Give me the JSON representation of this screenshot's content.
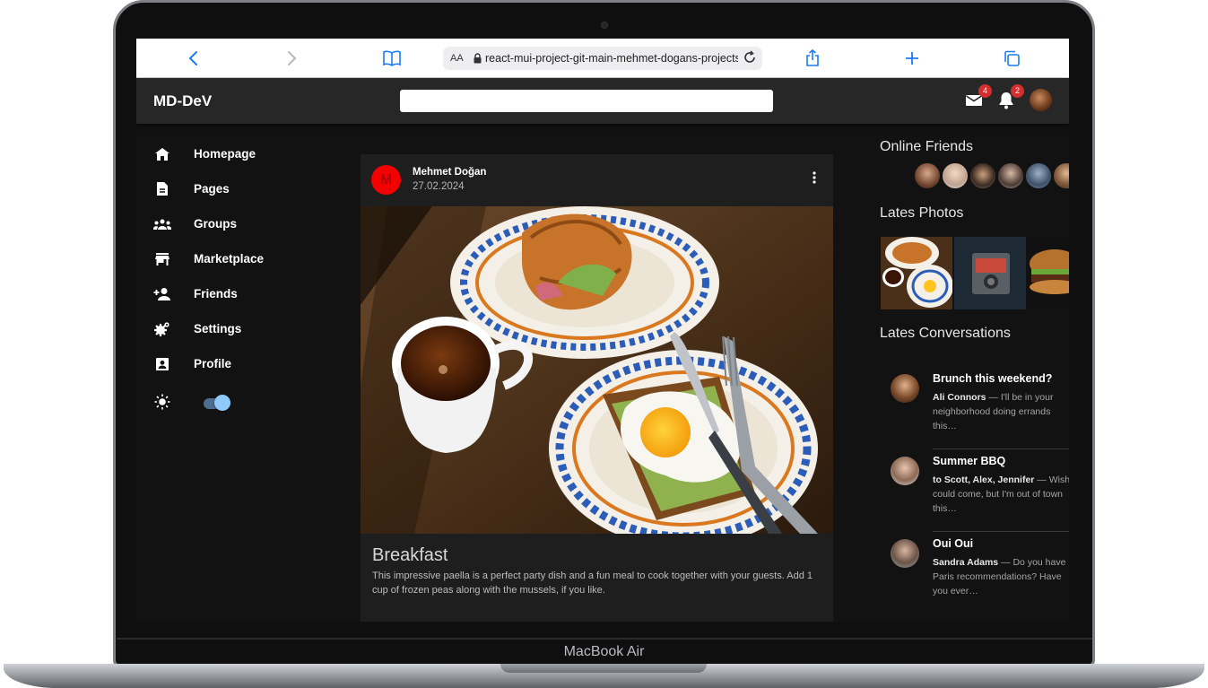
{
  "device": {
    "brand_label": "MacBook Air"
  },
  "browser": {
    "text_size_label": "AA",
    "url": "react-mui-project-git-main-mehmet-dogans-projects.vercel.app",
    "icons": [
      "chevron-left-icon",
      "chevron-right-icon",
      "book-icon",
      "lock-icon",
      "reload-icon",
      "share-icon",
      "plus-icon",
      "tabs-icon"
    ]
  },
  "appbar": {
    "logo": "MD-DeV",
    "search_placeholder": "",
    "mail_badge": "4",
    "notifications_badge": "2"
  },
  "sidebar": {
    "items": [
      {
        "label": "Homepage",
        "icon": "home-icon"
      },
      {
        "label": "Pages",
        "icon": "article-icon"
      },
      {
        "label": "Groups",
        "icon": "groups-icon"
      },
      {
        "label": "Marketplace",
        "icon": "store-icon"
      },
      {
        "label": "Friends",
        "icon": "person-add-icon"
      },
      {
        "label": "Settings",
        "icon": "settings-icon"
      },
      {
        "label": "Profile",
        "icon": "account-box-icon"
      }
    ],
    "theme_toggle": {
      "icon": "sun-icon",
      "on": true
    }
  },
  "post": {
    "avatar_letter": "M",
    "author": "Mehmet Doğan",
    "date": "27.02.2024",
    "title": "Breakfast",
    "description": "This impressive paella is a perfect party dish and a fun meal to cook together with your guests. Add 1 cup of frozen peas along with the mussels, if you like."
  },
  "rightbar": {
    "online_title": "Online Friends",
    "photos_title": "Lates Photos",
    "conversations_title": "Lates Conversations",
    "conversations": [
      {
        "title": "Brunch this weekend?",
        "sender": "Ali Connors",
        "message": " — I'll be in your neighborhood doing errands this…"
      },
      {
        "title": "Summer BBQ",
        "sender": "to Scott, Alex, Jennifer",
        "message": " — Wish I could come, but I'm out of town this…"
      },
      {
        "title": "Oui Oui",
        "sender": "Sandra Adams",
        "message": " — Do you have Paris recommendations? Have you ever…"
      }
    ]
  },
  "colors": {
    "accent": "#90caf9",
    "badge": "#d32f2f",
    "avatar": "#f40000",
    "appbar": "#272727",
    "background": "#121212",
    "card": "#1e1e1e"
  }
}
